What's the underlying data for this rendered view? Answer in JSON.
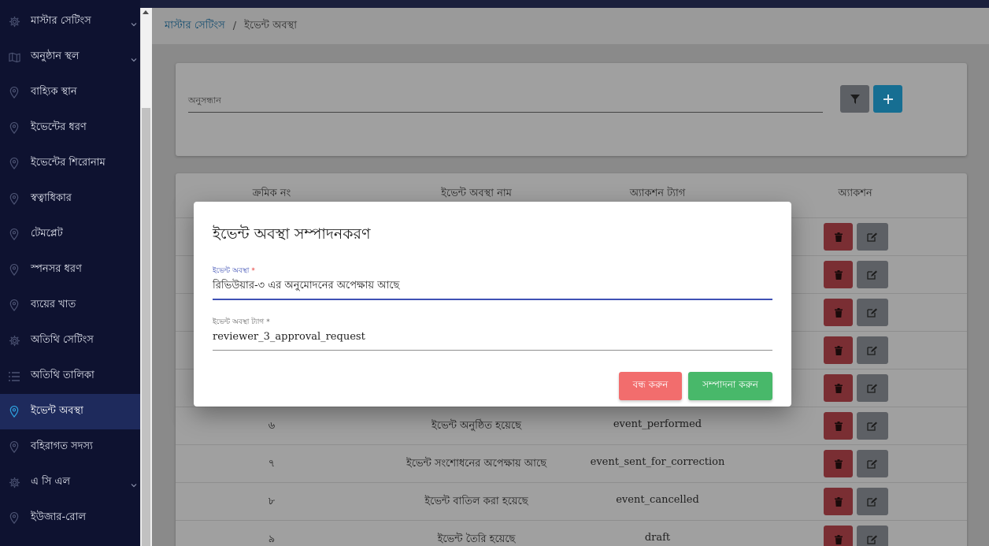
{
  "sidebar": {
    "items": [
      {
        "label": "মাস্টার সেটিংস",
        "icon": "gear-icon",
        "chevron": true
      },
      {
        "label": "অনুষ্ঠান স্থল",
        "icon": "map-icon",
        "chevron": true
      },
      {
        "label": "বাহ্যিক স্থান",
        "icon": "location-pin-icon",
        "chevron": false
      },
      {
        "label": "ইভেন্টের ধরণ",
        "icon": "location-pin-icon",
        "chevron": false
      },
      {
        "label": "ইভেন্টের শিরোনাম",
        "icon": "location-pin-icon",
        "chevron": false
      },
      {
        "label": "স্বত্বাধিকার",
        "icon": "location-pin-icon",
        "chevron": false
      },
      {
        "label": "টেমপ্লেট",
        "icon": "location-pin-icon",
        "chevron": false
      },
      {
        "label": "স্পনসর ধরণ",
        "icon": "location-pin-icon",
        "chevron": false
      },
      {
        "label": "ব্যয়ের খাত",
        "icon": "location-pin-icon",
        "chevron": false
      },
      {
        "label": "অতিথি সেটিংস",
        "icon": "gear-icon",
        "chevron": false
      },
      {
        "label": "অতিথি তালিকা",
        "icon": "list-icon",
        "chevron": false
      },
      {
        "label": "ইভেন্ট অবস্থা",
        "icon": "location-pin-icon",
        "chevron": false,
        "active": true
      },
      {
        "label": "বহিরাগত সদস্য",
        "icon": "location-pin-icon",
        "chevron": false
      },
      {
        "label": "এ সি এল",
        "icon": "gear-icon",
        "chevron": true
      },
      {
        "label": "ইউজার-রোল",
        "icon": "location-pin-icon",
        "chevron": false
      }
    ]
  },
  "breadcrumb": {
    "parent": "মাস্টার সেটিংস",
    "separator": "/",
    "current": "ইভেন্ট অবস্থা"
  },
  "search": {
    "label": "অনুসন্ধান"
  },
  "table": {
    "headers": [
      "ক্রমিক নং",
      "ইভেন্ট অবস্থা নাম",
      "অ্যাকশন ট্যাগ",
      "অ্যাকশন"
    ],
    "rows": [
      {
        "sl": "",
        "name": "",
        "tag": ""
      },
      {
        "sl": "",
        "name": "",
        "tag": ""
      },
      {
        "sl": "",
        "name": "",
        "tag": ""
      },
      {
        "sl": "",
        "name": "",
        "tag": ""
      },
      {
        "sl": "",
        "name": "",
        "tag": ""
      },
      {
        "sl": "৬",
        "name": "ইভেন্ট অনুষ্ঠিত হয়েছে",
        "tag": "event_performed"
      },
      {
        "sl": "৭",
        "name": "ইভেন্ট সংশোধনের অপেক্ষায় আছে",
        "tag": "event_sent_for_correction"
      },
      {
        "sl": "৮",
        "name": "ইভেন্ট বাতিল করা হয়েছে",
        "tag": "event_cancelled"
      },
      {
        "sl": "৯",
        "name": "ইভেন্ট তৈরি হয়েছে",
        "tag": "draft"
      }
    ]
  },
  "modal": {
    "title": "ইভেন্ট অবস্থা সম্পাদনকরণ",
    "field1_label": "ইভেন্ট অবস্থা",
    "field1_value": "রিভিউয়ার-৩ এর অনুমোদনের অপেক্ষায় আছে",
    "field2_label": "ইভেন্ট অবস্থা ট্যাগ",
    "field2_value": "reviewer_3_approval_request",
    "required_mark": "*",
    "close_label": "বন্ধ করুন",
    "save_label": "সম্পাদনা করুন"
  },
  "colors": {
    "sidebar_bg": "#0e1230",
    "active_item_bg": "#1e2a5c",
    "accent_blue": "#3f51b5",
    "delete_red": "#d9534f",
    "edit_gray": "#6c757d",
    "close_btn": "#f26d6d",
    "save_btn": "#48b86a",
    "add_btn": "#1f9bd1"
  }
}
